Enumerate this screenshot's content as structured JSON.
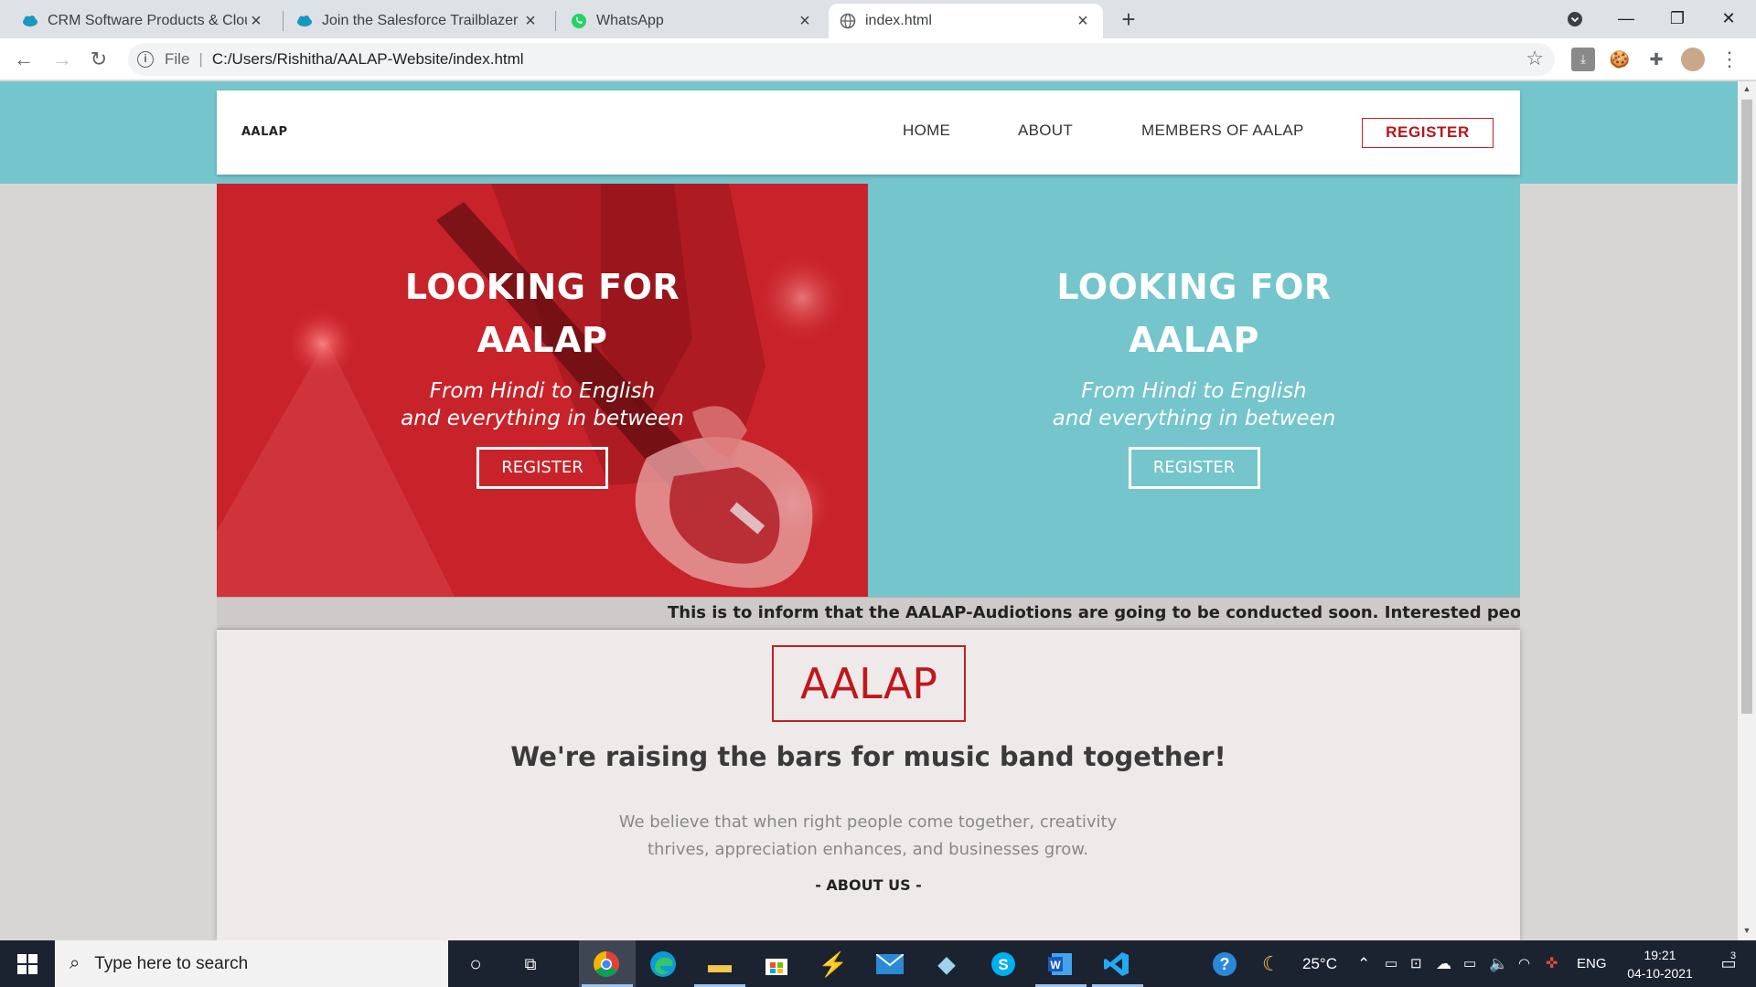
{
  "browser": {
    "tabs": [
      {
        "title": "CRM Software Products & Cloud",
        "icon": "salesforce-cloud-icon",
        "active": false
      },
      {
        "title": "Join the Salesforce Trailblazer Co",
        "icon": "salesforce-cloud-icon",
        "active": false
      },
      {
        "title": "WhatsApp",
        "icon": "whatsapp-icon",
        "active": false
      },
      {
        "title": "index.html",
        "icon": "globe-icon",
        "active": true
      }
    ],
    "address": {
      "scheme": "File",
      "url": "C:/Users/Rishitha/AALAP-Website/index.html"
    }
  },
  "site": {
    "brand": "AALAP",
    "nav": {
      "home": "HOME",
      "about": "ABOUT",
      "members": "MEMBERS OF AALAP",
      "register": "REGISTER"
    },
    "hero": {
      "left": {
        "title": "LOOKING FOR AALAP",
        "sub_line1": "From Hindi to English",
        "sub_line2": "and everything in between",
        "button": "REGISTER"
      },
      "right": {
        "title": "LOOKING FOR AALAP",
        "sub_line1": "From Hindi to English",
        "sub_line2": "and everything in between",
        "button": "REGISTER"
      }
    },
    "marquee": "This is to inform that the AALAP-Audiotions are going to be conducted soon. Interested people c",
    "about": {
      "logo": "AALAP",
      "heading": "We're raising the bars for music band together!",
      "text": "We believe that when right people come together, creativity thrives, appreciation enhances, and businesses grow.",
      "link": "- ABOUT US -"
    }
  },
  "taskbar": {
    "search_placeholder": "Type here to search",
    "weather": "25°C",
    "language": "ENG",
    "time": "19:21",
    "date": "04-10-2021",
    "notifications": "3"
  },
  "colors": {
    "accent_red": "#c91d22",
    "teal": "#74c5cc",
    "hero_red": "#d3252c"
  }
}
